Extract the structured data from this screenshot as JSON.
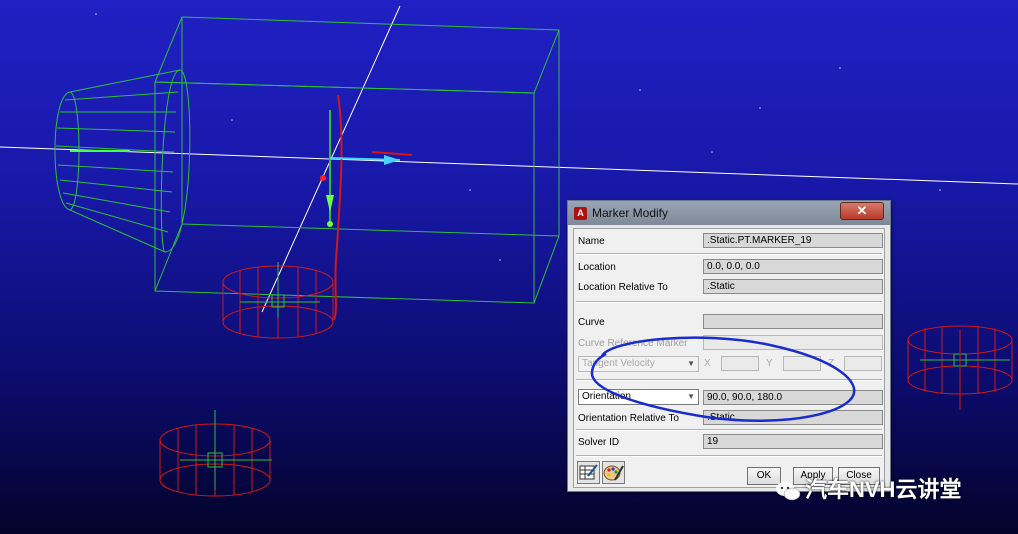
{
  "dialog": {
    "title": "Marker Modify",
    "app_icon": "A",
    "close_symbol": "✕",
    "name_label": "Name",
    "name_value": ".Static.PT.MARKER_19",
    "location_label": "Location",
    "location_value": "0.0, 0.0, 0.0",
    "location_rel_label": "Location Relative To",
    "location_rel_value": ".Static",
    "curve_label": "Curve",
    "curve_value": "",
    "curve_ref_label": "Curve Reference Marker",
    "curve_ref_value": "",
    "tangent_option": "Tangent Velocity",
    "x_label": "X",
    "y_label": "Y",
    "z_label": "Z",
    "orientation_option": "Orientation",
    "orientation_value": "90.0, 90.0, 180.0",
    "orientation_rel_label": "Orientation Relative To",
    "orientation_rel_value": ".Static",
    "solver_label": "Solver ID",
    "solver_value": "19",
    "ok_label": "OK",
    "apply_label": "Apply",
    "close_label": "Close",
    "tool_icons": [
      "table-editor-icon",
      "paint-palette-icon"
    ]
  },
  "viewport": {
    "background_top": "#2020c4",
    "background_bottom": "#03032a",
    "wire_green": "#2dbf3a",
    "wire_red": "#d01818",
    "annotation_color": "#1a2ccc"
  },
  "watermark": {
    "text": "汽车NVH云讲堂",
    "icon": "wechat-icon"
  }
}
